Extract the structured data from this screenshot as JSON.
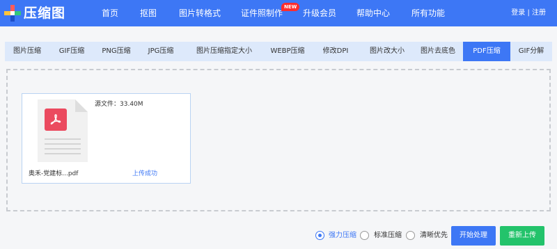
{
  "brand": {
    "name": "压缩图",
    "logo_icon": "plus-logo-icon"
  },
  "nav": {
    "items": [
      "首页",
      "抠图",
      "图片转格式",
      "证件照制作",
      "升级会员",
      "帮助中心",
      "所有功能"
    ],
    "badge": "NEW",
    "login": "登录",
    "separator": "|",
    "register": "注册"
  },
  "tabs": [
    "图片压缩",
    "GIF压缩",
    "PNG压缩",
    "JPG压缩",
    "图片压缩指定大小",
    "WEBP压缩",
    "修改DPI",
    "图片改大小",
    "图片去底色",
    "PDF压缩",
    "GIF分解"
  ],
  "active_tab": "PDF压缩",
  "file": {
    "source_size": "源文件：33.40M",
    "name": "奥禾-党建标...pdf",
    "status": "上传成功",
    "icon": "pdf-file-icon"
  },
  "options": {
    "items": [
      "强力压缩",
      "标准压缩",
      "清晰优先"
    ],
    "selected": "强力压缩"
  },
  "buttons": {
    "start": "开始处理",
    "reupload": "重新上传"
  },
  "colors": {
    "primary": "#3d77f5",
    "success": "#23c36b",
    "pdf": "#eb4a5f",
    "badge": "#ff2d2d"
  }
}
